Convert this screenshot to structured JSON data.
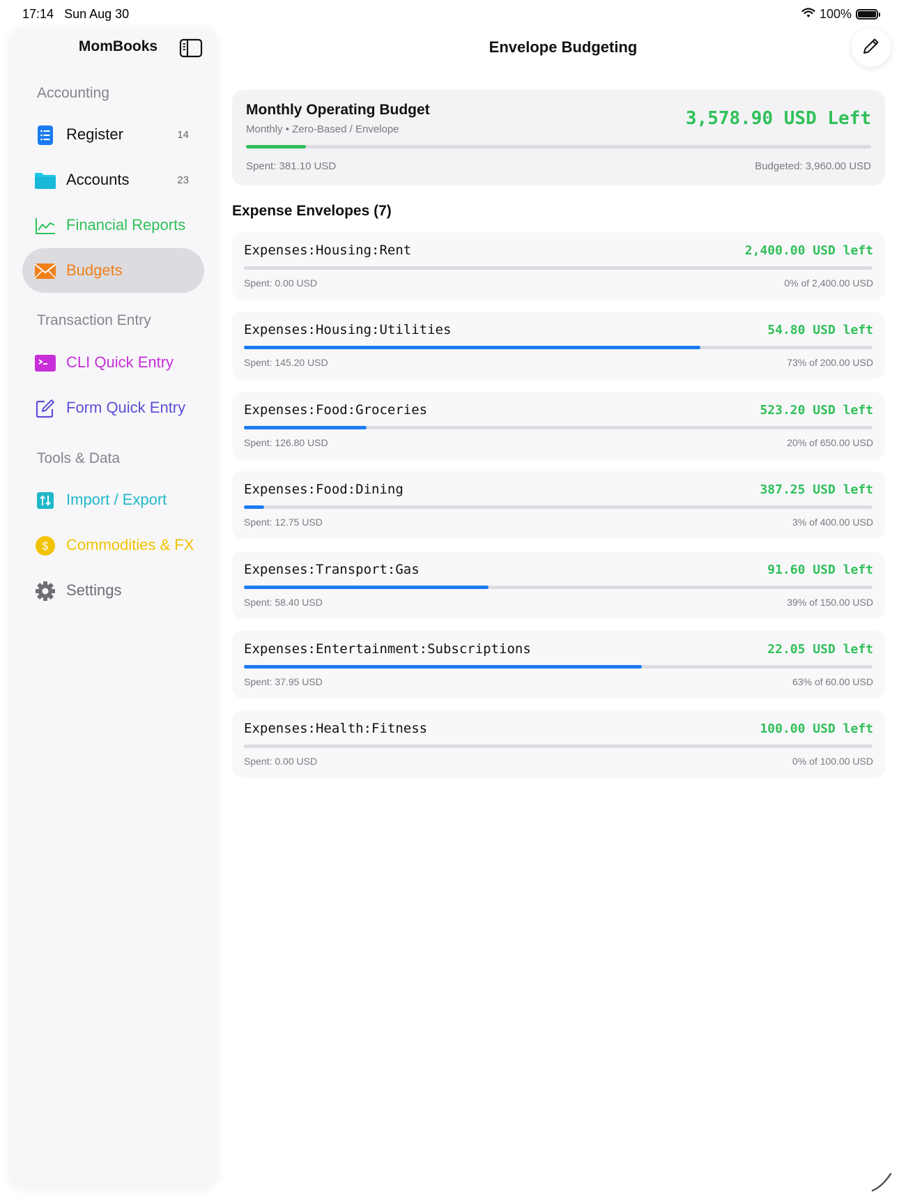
{
  "status_bar": {
    "time": "17:14",
    "date": "Sun Aug 30",
    "battery": "100%"
  },
  "sidebar": {
    "title": "MomBooks",
    "sections": [
      {
        "header": "Accounting"
      },
      {
        "header": "Transaction Entry"
      },
      {
        "header": "Tools & Data"
      }
    ],
    "items": [
      {
        "label": "Register",
        "count": "14",
        "color": "#1a7cf0",
        "icon": "list-icon"
      },
      {
        "label": "Accounts",
        "count": "23",
        "color": "#1cc6e8",
        "icon": "folder-icon"
      },
      {
        "label": "Financial Reports",
        "color": "#30c059",
        "icon": "chart-icon"
      },
      {
        "label": "Budgets",
        "color": "#f0801a",
        "icon": "envelope-icon",
        "selected": true
      },
      {
        "label": "CLI Quick Entry",
        "color": "#c72fd8",
        "icon": "terminal-icon"
      },
      {
        "label": "Form Quick Entry",
        "color": "#5b4fd6",
        "icon": "compose-icon"
      },
      {
        "label": "Import / Export",
        "color": "#20b8c8",
        "icon": "import-export-icon"
      },
      {
        "label": "Commodities & FX",
        "color": "#f2c300",
        "icon": "dollar-coin-icon"
      },
      {
        "label": "Settings",
        "color": "#6e6e73",
        "icon": "gear-icon"
      }
    ]
  },
  "header": {
    "title": "Envelope Budgeting"
  },
  "summary": {
    "name": "Monthly Operating Budget",
    "subtitle": "Monthly • Zero-Based / Envelope",
    "left": "3,578.90 USD Left",
    "spent": "Spent: 381.10 USD",
    "budgeted": "Budgeted: 3,960.00 USD",
    "progress": 0.096
  },
  "envelopes_title": "Expense Envelopes (7)",
  "envelopes": [
    {
      "name": "Expenses:Housing:Rent",
      "left": "2,400.00 USD left",
      "spent": "Spent: 0.00 USD",
      "pct_of": "0% of 2,400.00 USD",
      "progress": 0.0
    },
    {
      "name": "Expenses:Housing:Utilities",
      "left": "54.80 USD left",
      "spent": "Spent: 145.20 USD",
      "pct_of": "73% of 200.00 USD",
      "progress": 0.726
    },
    {
      "name": "Expenses:Food:Groceries",
      "left": "523.20 USD left",
      "spent": "Spent: 126.80 USD",
      "pct_of": "20% of 650.00 USD",
      "progress": 0.195
    },
    {
      "name": "Expenses:Food:Dining",
      "left": "387.25 USD left",
      "spent": "Spent: 12.75 USD",
      "pct_of": "3% of 400.00 USD",
      "progress": 0.032
    },
    {
      "name": "Expenses:Transport:Gas",
      "left": "91.60 USD left",
      "spent": "Spent: 58.40 USD",
      "pct_of": "39% of 150.00 USD",
      "progress": 0.389
    },
    {
      "name": "Expenses:Entertainment:Subscriptions",
      "left": "22.05 USD left",
      "spent": "Spent: 37.95 USD",
      "pct_of": "63% of 60.00 USD",
      "progress": 0.633
    },
    {
      "name": "Expenses:Health:Fitness",
      "left": "100.00 USD left",
      "spent": "Spent: 0.00 USD",
      "pct_of": "0% of 100.00 USD",
      "progress": 0.0
    }
  ]
}
